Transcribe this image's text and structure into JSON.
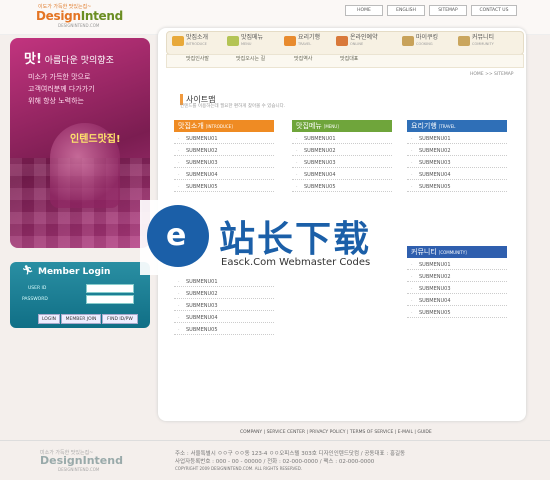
{
  "header": {
    "logo_tag": "이도가 가득한 맛있는집~",
    "logo_design": "Design",
    "logo_intend": "Intend",
    "logo_sub": "DESIGNINTEND.COM",
    "topnav": [
      "HOME",
      "ENGLISH",
      "SITEMAP",
      "CONTACT US"
    ]
  },
  "promo": {
    "title": "맛!",
    "title_rest": " 아름다운 맛의향조",
    "lines": [
      "미소가 가득한 맛으로",
      "고객여러분께 다가가기",
      "위해 항상 노력하는"
    ],
    "highlight": "인텐드맛집!"
  },
  "login": {
    "icon": "run-icon",
    "title": "Member Login",
    "user_label": "USER ID",
    "pass_label": "PASSWORD",
    "buttons": [
      "LOGIN",
      "MEMBER JOIN",
      "FIND ID/PW"
    ]
  },
  "menu": [
    {
      "label": "맛집소개",
      "sub": "INTRODUCE",
      "color": "#e8a93a"
    },
    {
      "label": "맛집메뉴",
      "sub": "MENU",
      "color": "#b4c455"
    },
    {
      "label": "요리기행",
      "sub": "TRAVEL",
      "color": "#e88b2e"
    },
    {
      "label": "온라인예약",
      "sub": "ONLINE",
      "color": "#d9793a"
    },
    {
      "label": "마이쿠킹",
      "sub": "COOKING",
      "color": "#c8a25a"
    },
    {
      "label": "커뮤니티",
      "sub": "COMMUNITY",
      "color": "#caa65e"
    }
  ],
  "submenu": [
    "맛집인사말",
    "맛집오시는 길",
    "맛집역사",
    "맛집대표"
  ],
  "breadcrumb": "HOME  >>  SITEMAP",
  "page_title": "사이트맵",
  "page_desc": "인텐드를 이용하는데 필요한 편하게 찾아볼 수 있습니다.",
  "categories": [
    {
      "name": "맛집소개",
      "sub": "[INTRODUCE]",
      "color": "#ef8b23",
      "items": [
        "SUBMENU01",
        "SUBMENU02",
        "SUBMENU03",
        "SUBMENU04",
        "SUBMENU05"
      ]
    },
    {
      "name": "맛집메뉴",
      "sub": "[MENU]",
      "color": "#6fa53b",
      "items": [
        "SUBMENU01",
        "SUBMENU02",
        "SUBMENU03",
        "SUBMENU04",
        "SUBMENU05"
      ]
    },
    {
      "name": "요리기행",
      "sub": "[TRAVEL",
      "color": "#2f6fb7",
      "items": [
        "SUBMENU01",
        "SUBMENU02",
        "SUBMENU03",
        "SUBMENU04",
        "SUBMENU05"
      ]
    },
    {
      "name": "커뮤니티",
      "sub": "[COMMUNITY]",
      "color": "#2f5fae",
      "items": [
        "SUBMENU01",
        "SUBMENU02",
        "SUBMENU03",
        "SUBMENU04",
        "SUBMENU05"
      ]
    }
  ],
  "left_lower_items": [
    "SUBMENU01",
    "SUBMENU02",
    "SUBMENU03",
    "SUBMENU04",
    "SUBMENU05"
  ],
  "watermark": {
    "cn": "站长下载",
    "en": "Easck.Com Webmaster Codes",
    "icon": "e-logo-icon"
  },
  "footer": {
    "links": "COMPANY  |  SERVICE CENTER  |  PRIVACY POLICY  |  TERMS OF SERVICE  |  E-MAIL  |  GUIDE",
    "logo_tag": "미소가 가득한 맛있는집~",
    "logo": "DesignIntend",
    "logo_sub": "DESIGNINTEND.COM",
    "info": [
      "주소 : 서울특별시 ㅇㅇ구 ㅇㅇ동 123-4 ㅇㅇ오피스텔 303호 디자인인텐드닷컴 / 공동대표 : 홍길동",
      "사업자등록번호 : 000 - 00 - 00000 / 전화 : 02-000-0000 / 팩스 : 02-000-0000",
      "COPYRIGHT 2009 DESIGNINTEND.COM. ALL RIGHTS RESERVED."
    ]
  }
}
